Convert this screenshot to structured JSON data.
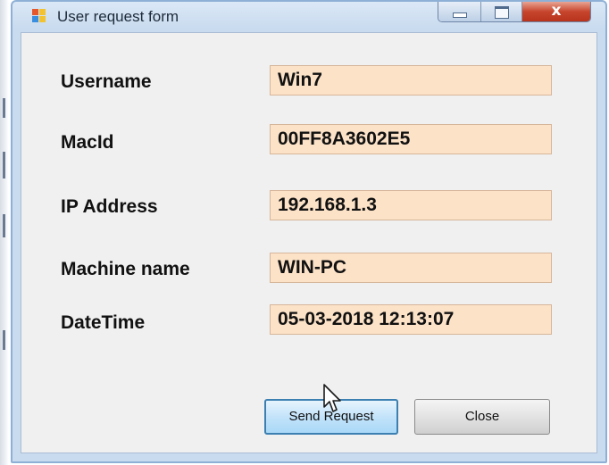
{
  "window": {
    "title": "User request form",
    "icon": "windows-forms-app-icon",
    "controls": [
      "minimize-icon",
      "maximize-icon",
      "close-icon"
    ],
    "close_glyph": "x"
  },
  "form": {
    "fields": [
      {
        "label": "Username",
        "value": "Win7"
      },
      {
        "label": "MacId",
        "value": "00FF8A3602E5"
      },
      {
        "label": "IP Address",
        "value": "192.168.1.3"
      },
      {
        "label": "Machine name",
        "value": "WIN-PC"
      },
      {
        "label": "DateTime",
        "value": "05-03-2018 12:13:07"
      }
    ],
    "buttons": {
      "send": "Send Request",
      "close": "Close"
    }
  },
  "colors": {
    "input_background": "#fce2c7",
    "focused_button_border": "#3c7fb1",
    "close_button": "#c7452d"
  }
}
